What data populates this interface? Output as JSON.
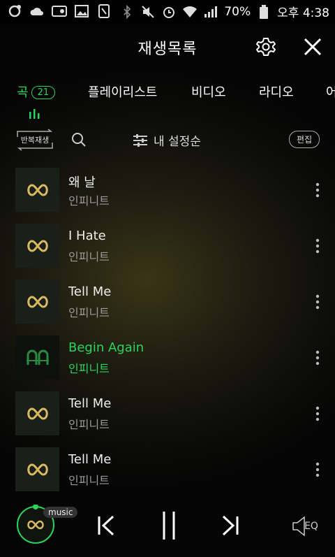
{
  "status": {
    "battery": "70%",
    "time": "오후 4:38"
  },
  "header": {
    "title": "재생목록"
  },
  "tabs": [
    {
      "label": "곡",
      "count": "21"
    },
    {
      "label": "플레이리스트"
    },
    {
      "label": "비디오"
    },
    {
      "label": "라디오"
    },
    {
      "label": "어"
    }
  ],
  "toolbar": {
    "repeat_label": "반복재생",
    "sort_label": "내 설정순",
    "edit_label": "편집"
  },
  "songs": [
    {
      "title": "왜 날",
      "artist": "인피니트"
    },
    {
      "title": "I Hate",
      "artist": "인피니트"
    },
    {
      "title": "Tell Me",
      "artist": "인피니트"
    },
    {
      "title": "Begin Again",
      "artist": "인피니트"
    },
    {
      "title": "Tell Me",
      "artist": "인피니트"
    },
    {
      "title": "Tell Me",
      "artist": "인피니트"
    }
  ],
  "player": {
    "music_label": "music",
    "eq_label": "EQ"
  },
  "colors": {
    "accent": "#2bd45a",
    "logo": "#d9b960"
  },
  "icons": [
    "settings-icon",
    "close-icon",
    "search-icon",
    "sort-sliders-icon",
    "more-vertical-icon",
    "prev-icon",
    "pause-icon",
    "next-icon",
    "eq-icon",
    "infinity-logo-icon"
  ]
}
